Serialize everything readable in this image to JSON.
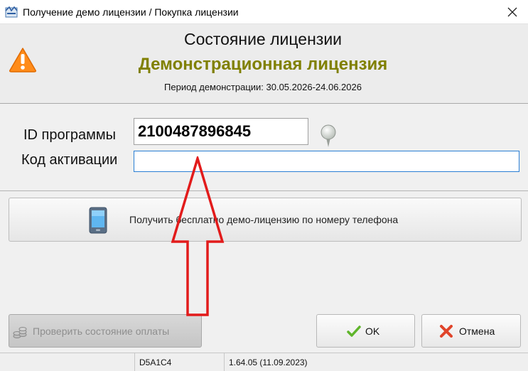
{
  "window": {
    "title": "Получение демо лицензии / Покупка лицензии"
  },
  "header": {
    "heading": "Состояние лицензии",
    "license_type": "Демонстрационная лицензия",
    "demo_period": "Период демонстрации: 30.05.2026-24.06.2026",
    "accent_color": "#808000"
  },
  "form": {
    "program_id_label": "ID программы",
    "program_id_value": "2100487896845",
    "activation_label": "Код активации",
    "activation_value": ""
  },
  "buttons": {
    "phone_demo": "Получить бесплатно демо-лицензию по номеру телефона",
    "check_payment": "Проверить состояние оплаты",
    "ok": "OK",
    "cancel": "Отмена"
  },
  "status": {
    "cell1": "",
    "code": "D5A1C4",
    "version": "1.64.05 (11.09.2023)"
  },
  "icons": {
    "app": "app-icon",
    "close": "close-icon",
    "warning": "warning-icon",
    "pin": "pin-icon",
    "phone": "phone-icon",
    "coins": "coins-icon",
    "ok": "checkmark-icon",
    "cancel": "cross-icon",
    "annotation": "red-arrow"
  }
}
